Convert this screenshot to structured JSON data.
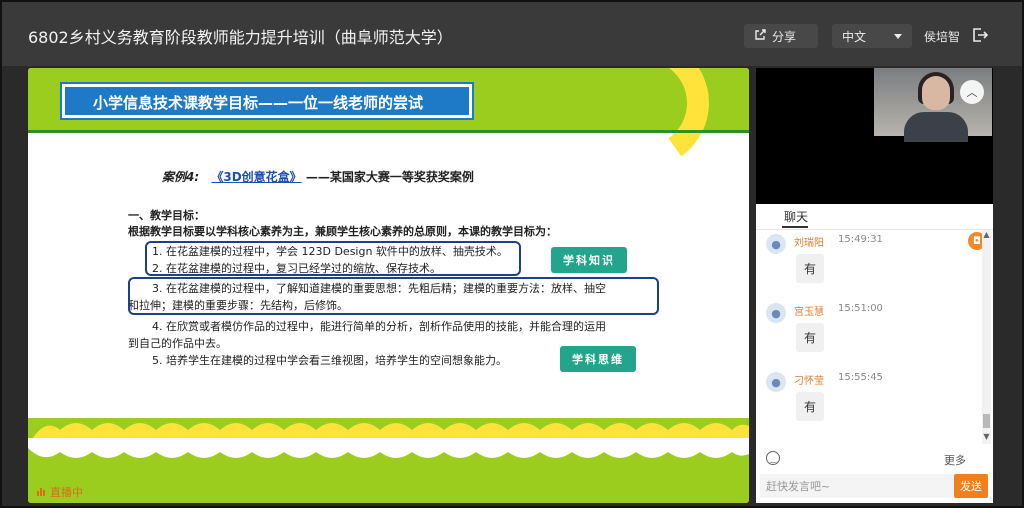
{
  "window": {
    "title": "6802乡村义务教育阶段教师能力提升培训（曲阜师范大学）"
  },
  "header": {
    "share_label": "分享",
    "language_label": "中文",
    "user_name": "侯培智"
  },
  "slide": {
    "title": "小学信息技术课教学目标——一位一线老师的尝试",
    "case_label": "案例4:",
    "case_link": "《3D创意花盒》",
    "case_rest": "——某国家大赛一等奖获奖案例",
    "section_heading": "一、教学目标：",
    "intro": "根据教学目标要以学科核心素养为主，兼顾学生核心素养的总原则，本课的教学目标为：",
    "goals": [
      "1. 在花盆建模的过程中，学会 123D Design 软件中的放样、抽壳技术。",
      "2. 在花盆建模的过程中，复习已经学过的缩放、保存技术。",
      "3. 在花盆建模的过程中，了解知道建模的重要思想：先粗后精；建模的重要方法：放样、抽空",
      "和拉伸；建模的重要步骤：先结构，后修饰。",
      "4. 在欣赏或者模仿作品的过程中，能进行简单的分析，剖析作品使用的技能，并能合理的运用",
      "到自己的作品中去。",
      "5. 培养学生在建模的过程中学会看三维视图，培养学生的空间想象能力。"
    ],
    "callout_knowledge": "学科知识",
    "callout_thinking": "学科思维"
  },
  "status": {
    "live": "直播中"
  },
  "chat": {
    "tab_label": "聊天",
    "messages": [
      {
        "sender": "刘瑞阳",
        "time": "15:49:31",
        "text": "有"
      },
      {
        "sender": "宫玉慧",
        "time": "15:51:00",
        "text": "有"
      },
      {
        "sender": "刁怀莹",
        "time": "15:55:45",
        "text": "有"
      }
    ],
    "more_label": "更多",
    "input_placeholder": "赶快发言吧~",
    "send_label": "发送"
  },
  "colors": {
    "slide_green": "#9acd1e",
    "slide_title_blue": "#1e79c6",
    "callout_teal": "#22a58a",
    "accent_orange": "#f0801e"
  },
  "icons": [
    "share-icon",
    "chevron-down-icon",
    "logout-icon",
    "collapse-icon",
    "live-icon",
    "avatar-icon",
    "gift-icon",
    "emoji-icon",
    "scroll-up-icon",
    "scroll-down-icon"
  ]
}
